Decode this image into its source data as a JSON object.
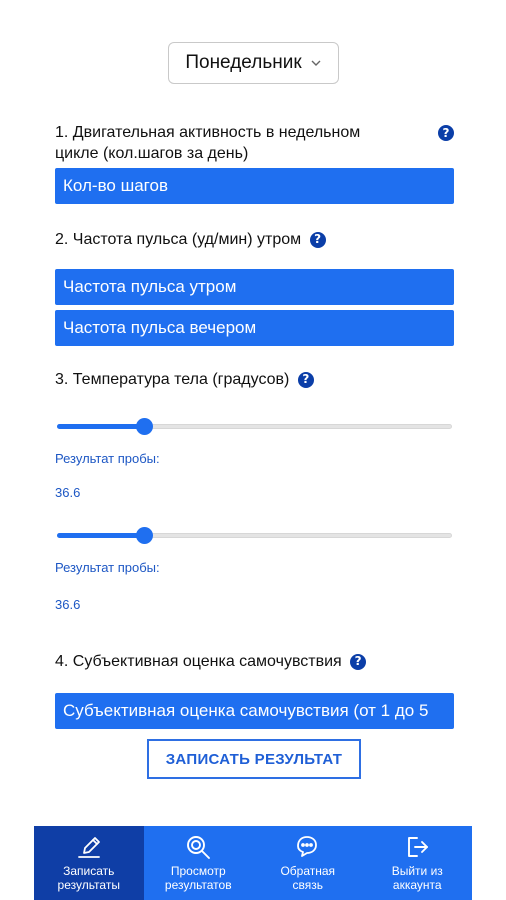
{
  "day_select": {
    "value": "Понедельник"
  },
  "questions": {
    "q1": {
      "label_line1": "1. Двигательная активность в недельном",
      "label_line2": "цикле (кол.шагов за день)",
      "field": "Кол-во шагов"
    },
    "q2": {
      "label": "2. Частота пульса (уд/мин) утром",
      "field_morning": "Частота пульса утром",
      "field_evening": "Частота пульса вечером"
    },
    "q3": {
      "label": "3. Температура тела (градусов)",
      "slider1": {
        "caption": "Результат пробы:",
        "value": "36.6",
        "fill_fraction": 0.22
      },
      "slider2": {
        "caption": "Результат пробы:",
        "value": "36.6",
        "fill_fraction": 0.22
      }
    },
    "q4": {
      "label": "4. Субъективная оценка самочувствия",
      "field": "Субъективная оценка самочувствия (от 1 до 5"
    }
  },
  "help_symbol": "?",
  "submit": {
    "label": "ЗАПИСАТЬ РЕЗУЛЬТАТ"
  },
  "nav": {
    "items": [
      {
        "line1": "Записать",
        "line2": "результаты",
        "icon": "pencil-icon",
        "active": true
      },
      {
        "line1": "Просмотр",
        "line2": "результатов",
        "icon": "search-icon",
        "active": false
      },
      {
        "line1": "Обратная",
        "line2": "связь",
        "icon": "chat-icon",
        "active": false
      },
      {
        "line1": "Выйти из",
        "line2": "аккаунта",
        "icon": "logout-icon",
        "active": false
      }
    ]
  },
  "colors": {
    "accent": "#1f6ff0",
    "active_nav": "#0f3ea6",
    "help_icon": "#0b3ea8"
  }
}
